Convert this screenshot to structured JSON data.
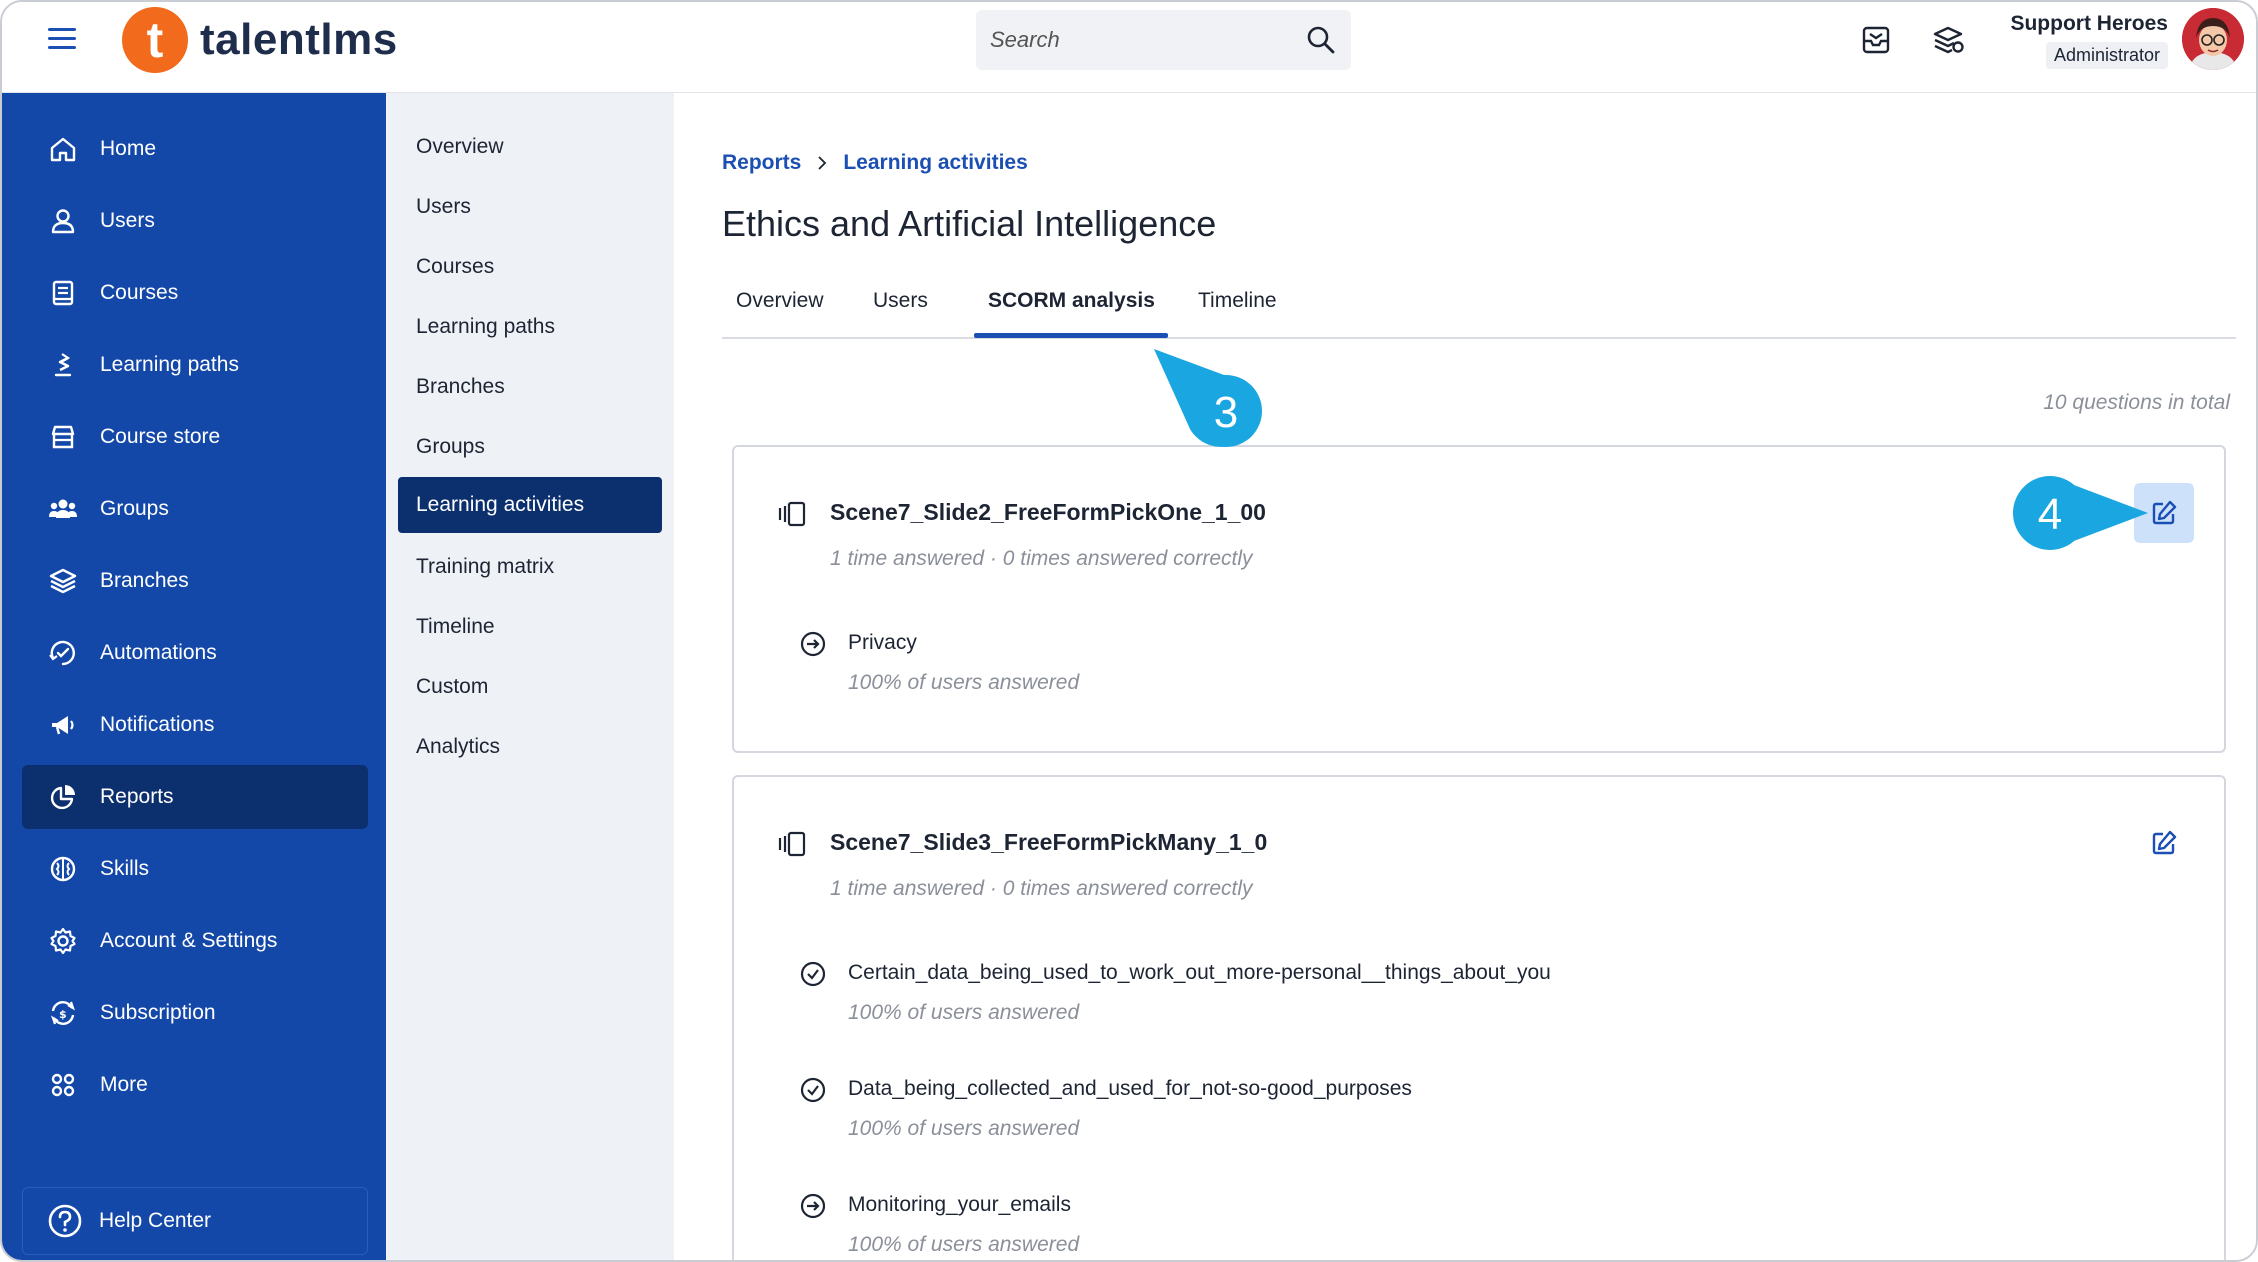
{
  "header": {
    "logo_text": "talentlms",
    "logo_mark": "t",
    "search_placeholder": "Search",
    "user_name": "Support Heroes",
    "user_role": "Administrator"
  },
  "sidebar": {
    "items": [
      {
        "label": "Home",
        "icon": "home-icon"
      },
      {
        "label": "Users",
        "icon": "user-icon"
      },
      {
        "label": "Courses",
        "icon": "book-icon"
      },
      {
        "label": "Learning paths",
        "icon": "path-icon"
      },
      {
        "label": "Course store",
        "icon": "store-icon"
      },
      {
        "label": "Groups",
        "icon": "groups-icon"
      },
      {
        "label": "Branches",
        "icon": "layers-icon"
      },
      {
        "label": "Automations",
        "icon": "automation-icon"
      },
      {
        "label": "Notifications",
        "icon": "megaphone-icon"
      },
      {
        "label": "Reports",
        "icon": "pie-chart-icon"
      },
      {
        "label": "Skills",
        "icon": "brain-icon"
      },
      {
        "label": "Account & Settings",
        "icon": "gear-icon"
      },
      {
        "label": "Subscription",
        "icon": "subscription-icon"
      },
      {
        "label": "More",
        "icon": "grid-icon"
      }
    ],
    "active": "Reports",
    "help_label": "Help Center"
  },
  "subnav": {
    "items": [
      "Overview",
      "Users",
      "Courses",
      "Learning paths",
      "Branches",
      "Groups",
      "Learning activities",
      "Training matrix",
      "Timeline",
      "Custom",
      "Analytics"
    ],
    "active": "Learning activities"
  },
  "main": {
    "breadcrumb": [
      "Reports",
      "Learning activities"
    ],
    "title": "Ethics and Artificial Intelligence",
    "tabs": [
      "Overview",
      "Users",
      "SCORM analysis",
      "Timeline"
    ],
    "active_tab": "SCORM analysis",
    "total": "10 questions in total",
    "questions": [
      {
        "title": "Scene7_Slide2_FreeFormPickOne_1_00",
        "meta": "1 time answered  ·  0 times answered correctly",
        "answers": [
          {
            "label": "Privacy",
            "sub": "100% of users answered",
            "icon": "arrow-circle-icon"
          }
        ]
      },
      {
        "title": "Scene7_Slide3_FreeFormPickMany_1_0",
        "meta": "1 time answered  ·  0 times answered correctly",
        "answers": [
          {
            "label": "Certain_data_being_used_to_work_out_more-personal__things_about_you",
            "sub": "100% of users answered",
            "icon": "check-circle-icon"
          },
          {
            "label": "Data_being_collected_and_used_for_not-so-good_purposes",
            "sub": "100% of users answered",
            "icon": "check-circle-icon"
          },
          {
            "label": "Monitoring_your_emails",
            "sub": "100% of users answered",
            "icon": "arrow-circle-icon"
          }
        ]
      }
    ]
  },
  "callouts": [
    "3",
    "4"
  ],
  "colors": {
    "brand_blue": "#1348a8",
    "active_dark": "#0c2f6e",
    "accent": "#1b4fb3",
    "logo_orange": "#f26a1b",
    "callout": "#1aa6e0"
  }
}
